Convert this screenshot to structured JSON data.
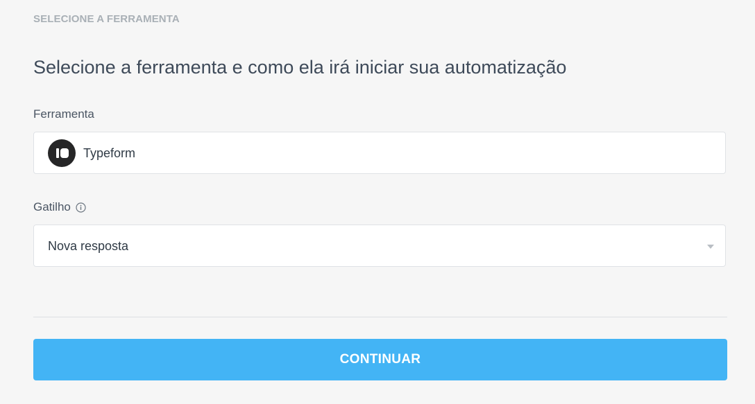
{
  "header": {
    "section_label": "SELECIONE A FERRAMENTA",
    "title": "Selecione a ferramenta e como ela irá iniciar sua automatização"
  },
  "tool": {
    "label": "Ferramenta",
    "value": "Typeform",
    "icon": "typeform-logo-icon"
  },
  "trigger": {
    "label": "Gatilho",
    "info_icon": "info-icon",
    "value": "Nova resposta"
  },
  "actions": {
    "continue_label": "CONTINUAR"
  },
  "colors": {
    "accent": "#43b4f5",
    "background": "#f6f6f6",
    "title_text": "#3e4a59",
    "muted_label": "#a9b0b6"
  }
}
